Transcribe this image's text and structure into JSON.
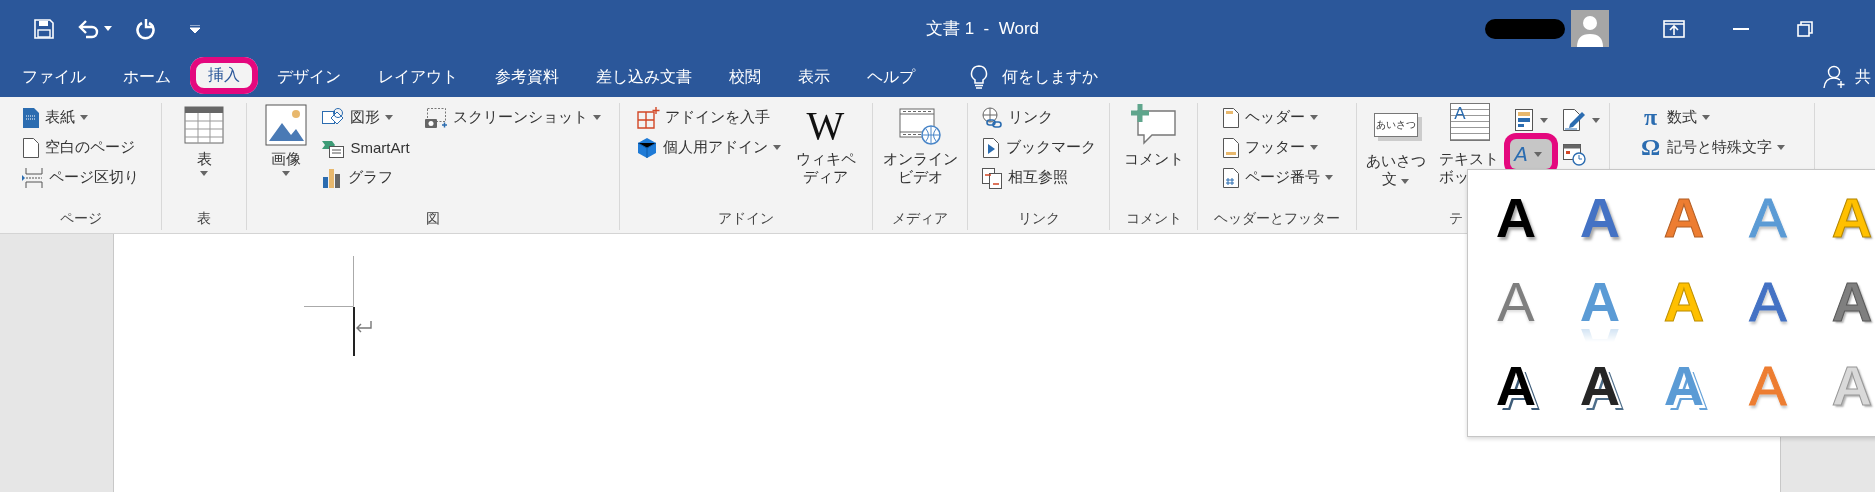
{
  "title_bar": {
    "title": "文書 1  -  Word"
  },
  "tabs": [
    {
      "label": "ファイル",
      "selected": false,
      "highlighted": false
    },
    {
      "label": "ホーム",
      "selected": false,
      "highlighted": false
    },
    {
      "label": "挿入",
      "selected": true,
      "highlighted": true
    },
    {
      "label": "デザイン",
      "selected": false,
      "highlighted": false
    },
    {
      "label": "レイアウト",
      "selected": false,
      "highlighted": false
    },
    {
      "label": "参考資料",
      "selected": false,
      "highlighted": false
    },
    {
      "label": "差し込み文書",
      "selected": false,
      "highlighted": false
    },
    {
      "label": "校閲",
      "selected": false,
      "highlighted": false
    },
    {
      "label": "表示",
      "selected": false,
      "highlighted": false
    },
    {
      "label": "ヘルプ",
      "selected": false,
      "highlighted": false
    }
  ],
  "tell_me": {
    "label": "何をしますか"
  },
  "share": {
    "label": "共"
  },
  "ribbon": {
    "groups": [
      {
        "label": "ページ",
        "items": [
          {
            "kind": "stack",
            "items": [
              {
                "kind": "small",
                "label": "表紙",
                "dropdown": true
              },
              {
                "kind": "small",
                "label": "空白のページ",
                "dropdown": false
              },
              {
                "kind": "small",
                "label": "ページ区切り",
                "dropdown": false
              }
            ]
          }
        ]
      },
      {
        "label": "表",
        "items": [
          {
            "kind": "large",
            "label": "表",
            "dropdown": true
          }
        ]
      },
      {
        "label": "図",
        "items": [
          {
            "kind": "large",
            "label": "画像",
            "dropdown": true
          },
          {
            "kind": "stack",
            "items": [
              {
                "kind": "small",
                "label": "図形",
                "dropdown": true
              },
              {
                "kind": "small",
                "label": "SmartArt",
                "dropdown": false
              },
              {
                "kind": "small",
                "label": "グラフ",
                "dropdown": false
              }
            ]
          },
          {
            "kind": "stack",
            "items": [
              {
                "kind": "small",
                "label": "スクリーンショット",
                "dropdown": true
              }
            ]
          }
        ]
      },
      {
        "label": "アドイン",
        "items": [
          {
            "kind": "stack",
            "items": [
              {
                "kind": "small",
                "label": "アドインを入手",
                "dropdown": false
              },
              {
                "kind": "small",
                "label": "個人用アドイン",
                "dropdown": true
              }
            ]
          },
          {
            "kind": "large",
            "label": "ウィキペディア",
            "glyph": "W",
            "dropdown": false
          }
        ]
      },
      {
        "label": "メディア",
        "items": [
          {
            "kind": "large",
            "label": "オンラインビデオ",
            "dropdown": false
          }
        ]
      },
      {
        "label": "リンク",
        "items": [
          {
            "kind": "stack",
            "items": [
              {
                "kind": "small",
                "label": "リンク",
                "dropdown": false
              },
              {
                "kind": "small",
                "label": "ブックマーク",
                "dropdown": false
              },
              {
                "kind": "small",
                "label": "相互参照",
                "dropdown": false
              }
            ]
          }
        ]
      },
      {
        "label": "コメント",
        "items": [
          {
            "kind": "large",
            "label": "コメント",
            "dropdown": false
          }
        ]
      },
      {
        "label": "ヘッダーとフッター",
        "items": [
          {
            "kind": "stack",
            "items": [
              {
                "kind": "small",
                "label": "ヘッダー",
                "dropdown": true
              },
              {
                "kind": "small",
                "label": "フッター",
                "dropdown": true
              },
              {
                "kind": "small",
                "label": "ページ番号",
                "dropdown": true
              }
            ]
          }
        ]
      },
      {
        "label": "テ",
        "items": [
          {
            "kind": "large",
            "label": "あいさつ文",
            "glyph": "あいさつ",
            "dropdown": true
          },
          {
            "kind": "large",
            "label": "テキストボッ",
            "glyph": "A",
            "dropdown": false
          },
          {
            "kind": "grid",
            "items": [
              {
                "kind": "icon",
                "dropdown": true,
                "highlighted": false
              },
              {
                "kind": "icon",
                "dropdown": true,
                "highlighted": false
              },
              {
                "kind": "icon",
                "glyph": "A",
                "dropdown": true,
                "highlighted": true
              },
              {
                "kind": "icon",
                "dropdown": false,
                "highlighted": false
              }
            ]
          }
        ]
      },
      {
        "items": [
          {
            "kind": "stack",
            "items": [
              {
                "kind": "small",
                "label": "数式",
                "glyph": "π",
                "dropdown": true
              },
              {
                "kind": "small",
                "label": "記号と特殊文字",
                "glyph": "Ω",
                "dropdown": true
              }
            ]
          }
        ]
      }
    ]
  },
  "wordart_gallery": {
    "styles": [
      {
        "sample": "A",
        "kind": "solid",
        "color": "#000000"
      },
      {
        "sample": "A",
        "kind": "solid",
        "color": "#4472c4"
      },
      {
        "sample": "A",
        "kind": "fill-light",
        "color": "#ed7d31"
      },
      {
        "sample": "A",
        "kind": "outline",
        "color": "#5b9bd5"
      },
      {
        "sample": "A",
        "kind": "bevel",
        "color": "#ffc000"
      },
      {
        "sample": "A",
        "kind": "gradient",
        "color": "#7f7f7f"
      },
      {
        "sample": "A",
        "kind": "reflection",
        "color": "#5b9bd5"
      },
      {
        "sample": "A",
        "kind": "fill-light",
        "color": "#ffc000"
      },
      {
        "sample": "A",
        "kind": "outline",
        "color": "#4472c4"
      },
      {
        "sample": "A",
        "kind": "bevel",
        "color": "#7f7f7f"
      },
      {
        "sample": "A",
        "kind": "shadow",
        "color": "#000000"
      },
      {
        "sample": "A",
        "kind": "shadow",
        "color": "#262626"
      },
      {
        "sample": "A",
        "kind": "shadow",
        "color": "#5b9bd5"
      },
      {
        "sample": "A",
        "kind": "outline",
        "color": "#ed7d31"
      },
      {
        "sample": "A",
        "kind": "bevel",
        "color": "#d9d9d9"
      }
    ]
  }
}
